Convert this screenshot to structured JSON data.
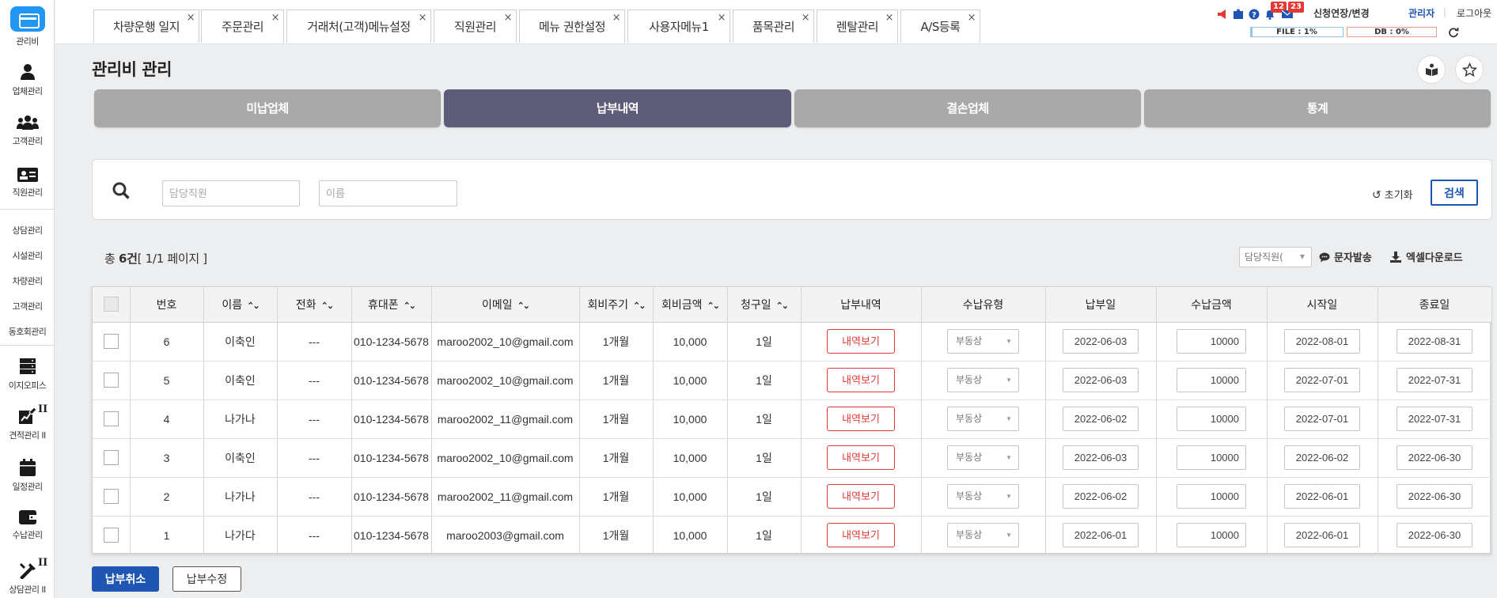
{
  "sidebar": {
    "items": [
      {
        "label": "관리비",
        "icon": "card-icon"
      },
      {
        "label": "업체관리",
        "icon": "person-icon"
      },
      {
        "label": "고객관리",
        "icon": "group-icon"
      },
      {
        "label": "직원관리",
        "icon": "id-card-icon"
      }
    ],
    "text_items": [
      "상담관리",
      "시설관리",
      "차량관리",
      "고객관리",
      "동호회관리"
    ],
    "lower_items": [
      {
        "label": "이지오피스",
        "icon": "server-icon"
      },
      {
        "label": "견적관리 II",
        "icon": "edit-chart-icon",
        "badge": "II"
      },
      {
        "label": "일정관리",
        "icon": "calendar-icon"
      },
      {
        "label": "수납관리",
        "icon": "wallet-icon"
      },
      {
        "label": "상담관리 II",
        "icon": "tools-icon",
        "badge": "II"
      }
    ]
  },
  "top_tabs": [
    "차량운행 일지",
    "주문관리",
    "거래처(고객)메뉴설정",
    "직원관리",
    "메뉴 권한설정",
    "사용자메뉴1",
    "품목관리",
    "렌탈관리",
    "A/S등록"
  ],
  "header_right": {
    "notification_count": "12",
    "message_count": "23",
    "extend_label": "신청연장/변경",
    "user_label": "관리자",
    "logout_label": "로그아웃",
    "file_meter": "FILE : 1%",
    "db_meter": "DB : 0%"
  },
  "page": {
    "title": "관리비 관리",
    "seg_tabs": [
      "미납업체",
      "납부내역",
      "결손업체",
      "통계"
    ],
    "active_tab": "납부내역"
  },
  "search": {
    "staff_placeholder": "담당직원",
    "name_placeholder": "이름",
    "reset_label": "초기화",
    "search_label": "검색"
  },
  "summary": {
    "prefix": "총 ",
    "count": "6건",
    "pages": "[ 1/1 페이지 ]",
    "staff_select": "담당직원(",
    "sms_label": "문자발송",
    "excel_label": "엑셀다운로드"
  },
  "table": {
    "headers": [
      "번호",
      "이름",
      "전화",
      "휴대폰",
      "이메일",
      "회비주기",
      "회비금액",
      "청구일",
      "납부내역",
      "수납유형",
      "납부일",
      "수납금액",
      "시작일",
      "종료일"
    ],
    "history_label": "내역보기",
    "rows": [
      {
        "no": "6",
        "name": "이축인",
        "phone": "---",
        "mobile": "010-1234-5678",
        "email": "maroo2002_10@gmail.com",
        "cycle": "1개월",
        "fee": "10,000",
        "bill_day": "1일",
        "pay_type": "부동상",
        "pay_date": "2022-06-03",
        "amount": "10000",
        "start": "2022-08-01",
        "end": "2022-08-31"
      },
      {
        "no": "5",
        "name": "이축인",
        "phone": "---",
        "mobile": "010-1234-5678",
        "email": "maroo2002_10@gmail.com",
        "cycle": "1개월",
        "fee": "10,000",
        "bill_day": "1일",
        "pay_type": "부동상",
        "pay_date": "2022-06-03",
        "amount": "10000",
        "start": "2022-07-01",
        "end": "2022-07-31"
      },
      {
        "no": "4",
        "name": "나가나",
        "phone": "---",
        "mobile": "010-1234-5678",
        "email": "maroo2002_11@gmail.com",
        "cycle": "1개월",
        "fee": "10,000",
        "bill_day": "1일",
        "pay_type": "부동상",
        "pay_date": "2022-06-02",
        "amount": "10000",
        "start": "2022-07-01",
        "end": "2022-07-31"
      },
      {
        "no": "3",
        "name": "이축인",
        "phone": "---",
        "mobile": "010-1234-5678",
        "email": "maroo2002_10@gmail.com",
        "cycle": "1개월",
        "fee": "10,000",
        "bill_day": "1일",
        "pay_type": "부동상",
        "pay_date": "2022-06-03",
        "amount": "10000",
        "start": "2022-06-02",
        "end": "2022-06-30"
      },
      {
        "no": "2",
        "name": "나가나",
        "phone": "---",
        "mobile": "010-1234-5678",
        "email": "maroo2002_11@gmail.com",
        "cycle": "1개월",
        "fee": "10,000",
        "bill_day": "1일",
        "pay_type": "부동상",
        "pay_date": "2022-06-02",
        "amount": "10000",
        "start": "2022-06-01",
        "end": "2022-06-30"
      },
      {
        "no": "1",
        "name": "나가다",
        "phone": "---",
        "mobile": "010-1234-5678",
        "email": "maroo2003@gmail.com",
        "cycle": "1개월",
        "fee": "10,000",
        "bill_day": "1일",
        "pay_type": "부동상",
        "pay_date": "2022-06-01",
        "amount": "10000",
        "start": "2022-06-01",
        "end": "2022-06-30"
      }
    ]
  },
  "footer": {
    "cancel_label": "납부취소",
    "edit_label": "납부수정"
  },
  "colors": {
    "accent": "#2196f3",
    "active_tab": "#5e5c78",
    "primary_button": "#1f56b3",
    "history_red": "#e53935"
  }
}
